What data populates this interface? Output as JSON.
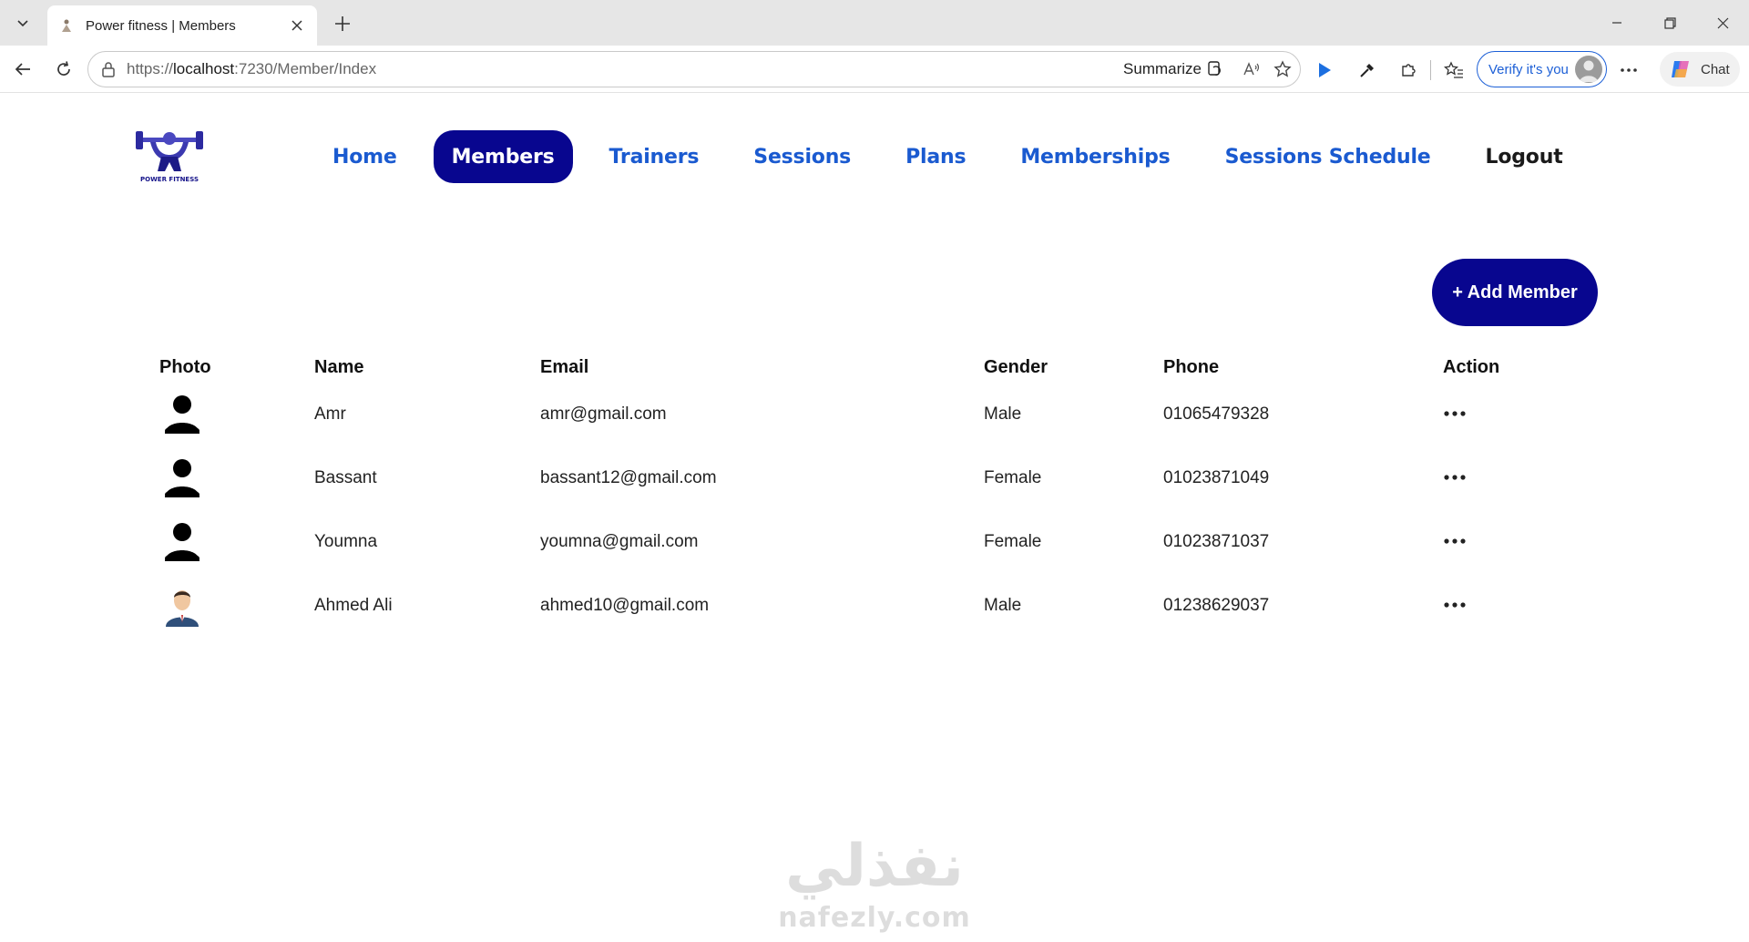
{
  "browser": {
    "tab_title": "Power fitness | Members",
    "url_prefix": "https://",
    "url_host": "localhost",
    "url_path": ":7230/Member/Index",
    "summarize_label": "Summarize",
    "verify_label": "Verify it's you",
    "chat_label": "Chat"
  },
  "nav": {
    "items": [
      {
        "label": "Home"
      },
      {
        "label": "Members"
      },
      {
        "label": "Trainers"
      },
      {
        "label": "Sessions"
      },
      {
        "label": "Plans"
      },
      {
        "label": "Memberships"
      },
      {
        "label": "Sessions Schedule"
      }
    ],
    "logout_label": "Logout",
    "active": "Members",
    "active_color": "#08068f",
    "link_color": "#1a5ad0"
  },
  "toolbar": {
    "add_member_label": "+ Add Member"
  },
  "table": {
    "headers": {
      "photo": "Photo",
      "name": "Name",
      "email": "Email",
      "gender": "Gender",
      "phone": "Phone",
      "action": "Action"
    },
    "rows": [
      {
        "photo": "default-avatar-icon",
        "name": "Amr",
        "email": "amr@gmail.com",
        "gender": "Male",
        "phone": "01065479328"
      },
      {
        "photo": "default-avatar-icon",
        "name": "Bassant",
        "email": "bassant12@gmail.com",
        "gender": "Female",
        "phone": "01023871049"
      },
      {
        "photo": "default-avatar-icon",
        "name": "Youmna",
        "email": "youmna@gmail.com",
        "gender": "Female",
        "phone": "01023871037"
      },
      {
        "photo": "businessman-avatar-icon",
        "name": "Ahmed Ali",
        "email": "ahmed10@gmail.com",
        "gender": "Male",
        "phone": "01238629037"
      }
    ]
  },
  "watermark": {
    "arabic": "نفذلي",
    "latin": "nafezly.com"
  }
}
